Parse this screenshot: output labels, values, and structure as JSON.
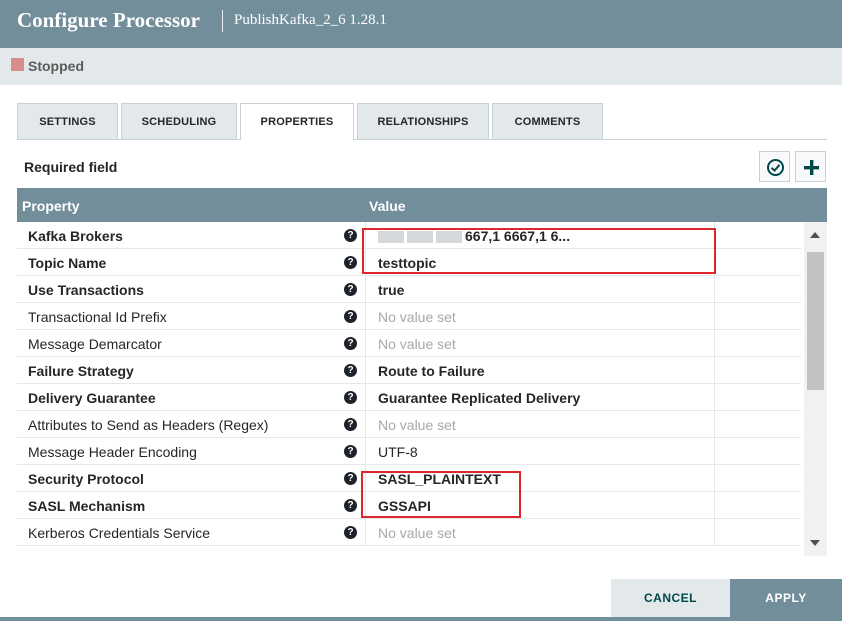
{
  "dialog": {
    "title": "Configure Processor",
    "subtitle": "PublishKafka_2_6 1.28.1"
  },
  "status": {
    "text": "Stopped",
    "color": "#d98c8c"
  },
  "tabs": [
    {
      "label": "SETTINGS",
      "active": false
    },
    {
      "label": "SCHEDULING",
      "active": false
    },
    {
      "label": "PROPERTIES",
      "active": true
    },
    {
      "label": "RELATIONSHIPS",
      "active": false
    },
    {
      "label": "COMMENTS",
      "active": false
    }
  ],
  "toolbar": {
    "required_label": "Required field",
    "verify_icon": "check-circle-icon",
    "add_icon": "plus-icon"
  },
  "grid": {
    "headers": {
      "property": "Property",
      "value": "Value"
    },
    "rows": [
      {
        "property": "Kafka Brokers",
        "required": true,
        "value": "667,1 6667,1 6...",
        "state": "set"
      },
      {
        "property": "Topic Name",
        "required": true,
        "value": "testtopic",
        "state": "set"
      },
      {
        "property": "Use Transactions",
        "required": true,
        "value": "true",
        "state": "set"
      },
      {
        "property": "Transactional Id Prefix",
        "required": false,
        "value": "No value set",
        "state": "unset"
      },
      {
        "property": "Message Demarcator",
        "required": false,
        "value": "No value set",
        "state": "unset"
      },
      {
        "property": "Failure Strategy",
        "required": true,
        "value": "Route to Failure",
        "state": "set"
      },
      {
        "property": "Delivery Guarantee",
        "required": true,
        "value": "Guarantee Replicated Delivery",
        "state": "set"
      },
      {
        "property": "Attributes to Send as Headers (Regex)",
        "required": false,
        "value": "No value set",
        "state": "unset"
      },
      {
        "property": "Message Header Encoding",
        "required": false,
        "value": "UTF-8",
        "state": "normal"
      },
      {
        "property": "Security Protocol",
        "required": true,
        "value": "SASL_PLAINTEXT",
        "state": "set"
      },
      {
        "property": "SASL Mechanism",
        "required": true,
        "value": "GSSAPI",
        "state": "set"
      },
      {
        "property": "Kerberos Credentials Service",
        "required": false,
        "value": "No value set",
        "state": "unset"
      }
    ]
  },
  "buttons": {
    "cancel": "CANCEL",
    "apply": "APPLY"
  },
  "colors": {
    "header_bg": "#728e9b",
    "highlight": "#e0262b"
  }
}
